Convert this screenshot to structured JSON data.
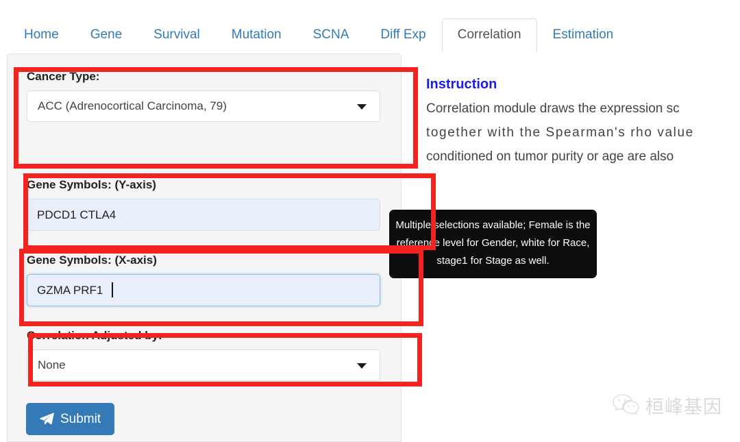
{
  "nav": {
    "tabs": [
      {
        "label": "Home",
        "active": false
      },
      {
        "label": "Gene",
        "active": false
      },
      {
        "label": "Survival",
        "active": false
      },
      {
        "label": "Mutation",
        "active": false
      },
      {
        "label": "SCNA",
        "active": false
      },
      {
        "label": "Diff Exp",
        "active": false
      },
      {
        "label": "Correlation",
        "active": true
      },
      {
        "label": "Estimation",
        "active": false
      }
    ]
  },
  "form": {
    "cancer_type": {
      "label": "Cancer Type:",
      "value": "ACC (Adrenocortical Carcinoma, 79)"
    },
    "gene_y": {
      "label": "Gene Symbols: (Y-axis)",
      "value": "PDCD1 CTLA4"
    },
    "gene_x": {
      "label": "Gene Symbols: (X-axis)",
      "value": "GZMA PRF1"
    },
    "adjusted_by": {
      "label": "Correlation Adjusted by:",
      "value": "None"
    },
    "submit_label": "Submit"
  },
  "instruction": {
    "title": "Instruction",
    "lines": [
      "Correlation module draws the expression sc",
      "together with the Spearman's rho value",
      "conditioned on tumor purity or age are also"
    ]
  },
  "tooltip": {
    "text": "Multiple selections available; Female is the reference level for Gender, white for Race, stage1 for Stage as well."
  },
  "watermark": {
    "text": "桓峰基因"
  },
  "colors": {
    "link": "#337ab7",
    "annotation": "#f4231f",
    "instruction_title": "#1a1aee",
    "panel_bg": "#f5f5f5",
    "input_bg": "#e8eefa",
    "tooltip_bg": "#0d0d0d"
  }
}
